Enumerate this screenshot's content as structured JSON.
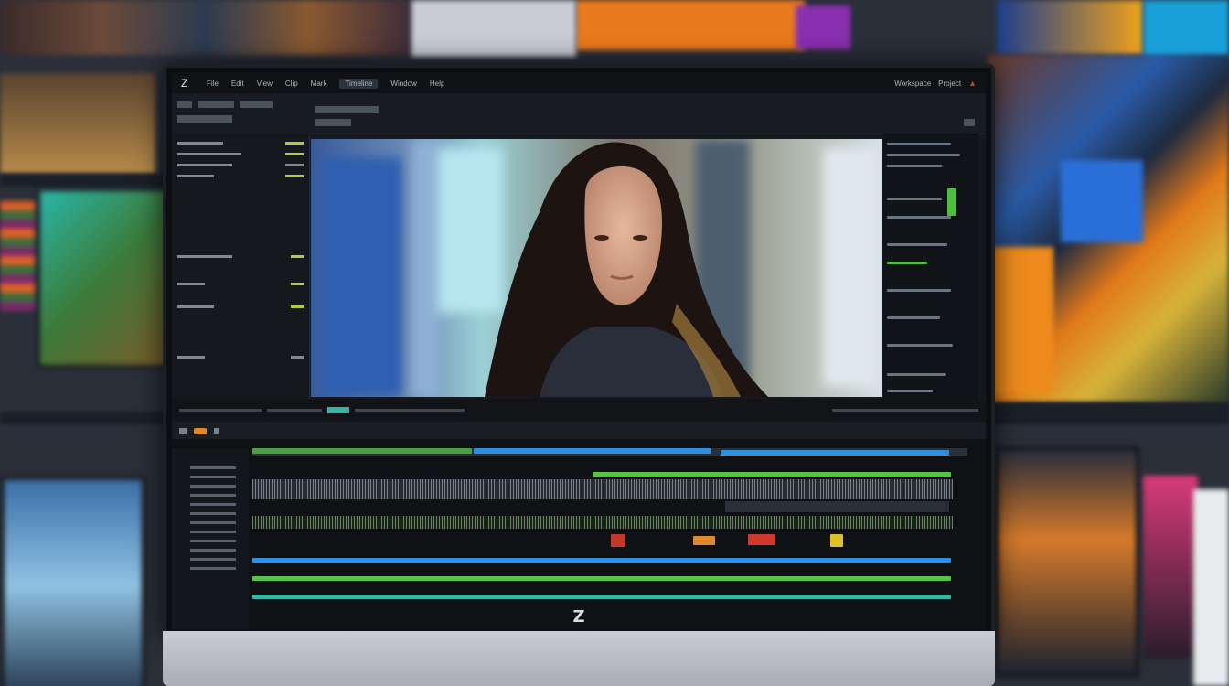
{
  "menubar": {
    "logo": "Z",
    "items": [
      "File",
      "Edit",
      "View",
      "Clip",
      "Mark",
      "Timeline",
      "Window",
      "Help"
    ],
    "active_index": 5,
    "right_items": [
      "Workspace",
      "Project"
    ]
  },
  "monitor": {
    "brand_logo": "Z"
  },
  "icons": {
    "close": "close-icon",
    "logo": "logo-icon"
  },
  "colors": {
    "accent_green": "#57c14a",
    "accent_blue": "#2f8fe0",
    "accent_teal": "#3bb3a3",
    "accent_orange": "#e0892a",
    "close_red": "#d0392b"
  }
}
